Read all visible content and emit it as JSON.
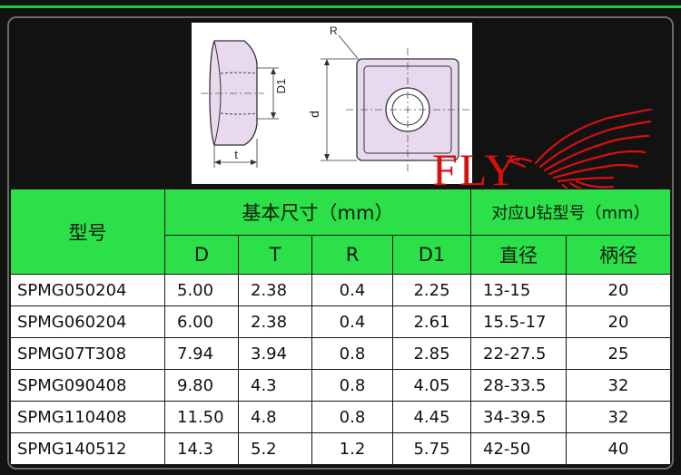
{
  "diagram": {
    "label_R": "R",
    "label_D1": "D1",
    "label_d": "d",
    "label_t": "t"
  },
  "logo": {
    "text": "FLY",
    "description": "red eagle emblem"
  },
  "table": {
    "header": {
      "model": "型号",
      "basic_size": "基本尺寸（mm）",
      "drill": "对应U钻型号（mm）",
      "col_D": "D",
      "col_T": "T",
      "col_R": "R",
      "col_D1": "D1",
      "col_diameter": "直径",
      "col_shank": "柄径"
    },
    "rows": [
      {
        "model": "SPMG050204",
        "D": "5.00",
        "T": "2.38",
        "R": "0.4",
        "D1": "2.25",
        "diameter": "13-15",
        "shank": "20"
      },
      {
        "model": "SPMG060204",
        "D": "6.00",
        "T": "2.38",
        "R": "0.4",
        "D1": "2.61",
        "diameter": "15.5-17",
        "shank": "20"
      },
      {
        "model": "SPMG07T308",
        "D": "7.94",
        "T": "3.94",
        "R": "0.8",
        "D1": "2.85",
        "diameter": "22-27.5",
        "shank": "25"
      },
      {
        "model": "SPMG090408",
        "D": "9.80",
        "T": "4.3",
        "R": "0.8",
        "D1": "4.05",
        "diameter": "28-33.5",
        "shank": "32"
      },
      {
        "model": "SPMG110408",
        "D": "11.50",
        "T": "4.8",
        "R": "0.8",
        "D1": "4.45",
        "diameter": "34-39.5",
        "shank": "32"
      },
      {
        "model": "SPMG140512",
        "D": "14.3",
        "T": "5.2",
        "R": "1.2",
        "D1": "5.75",
        "diameter": "42-50",
        "shank": "40"
      }
    ]
  },
  "colors": {
    "accent_green": "#2ce04a",
    "logo_red": "#d81010",
    "insert_purple": "#e9d9ee"
  }
}
